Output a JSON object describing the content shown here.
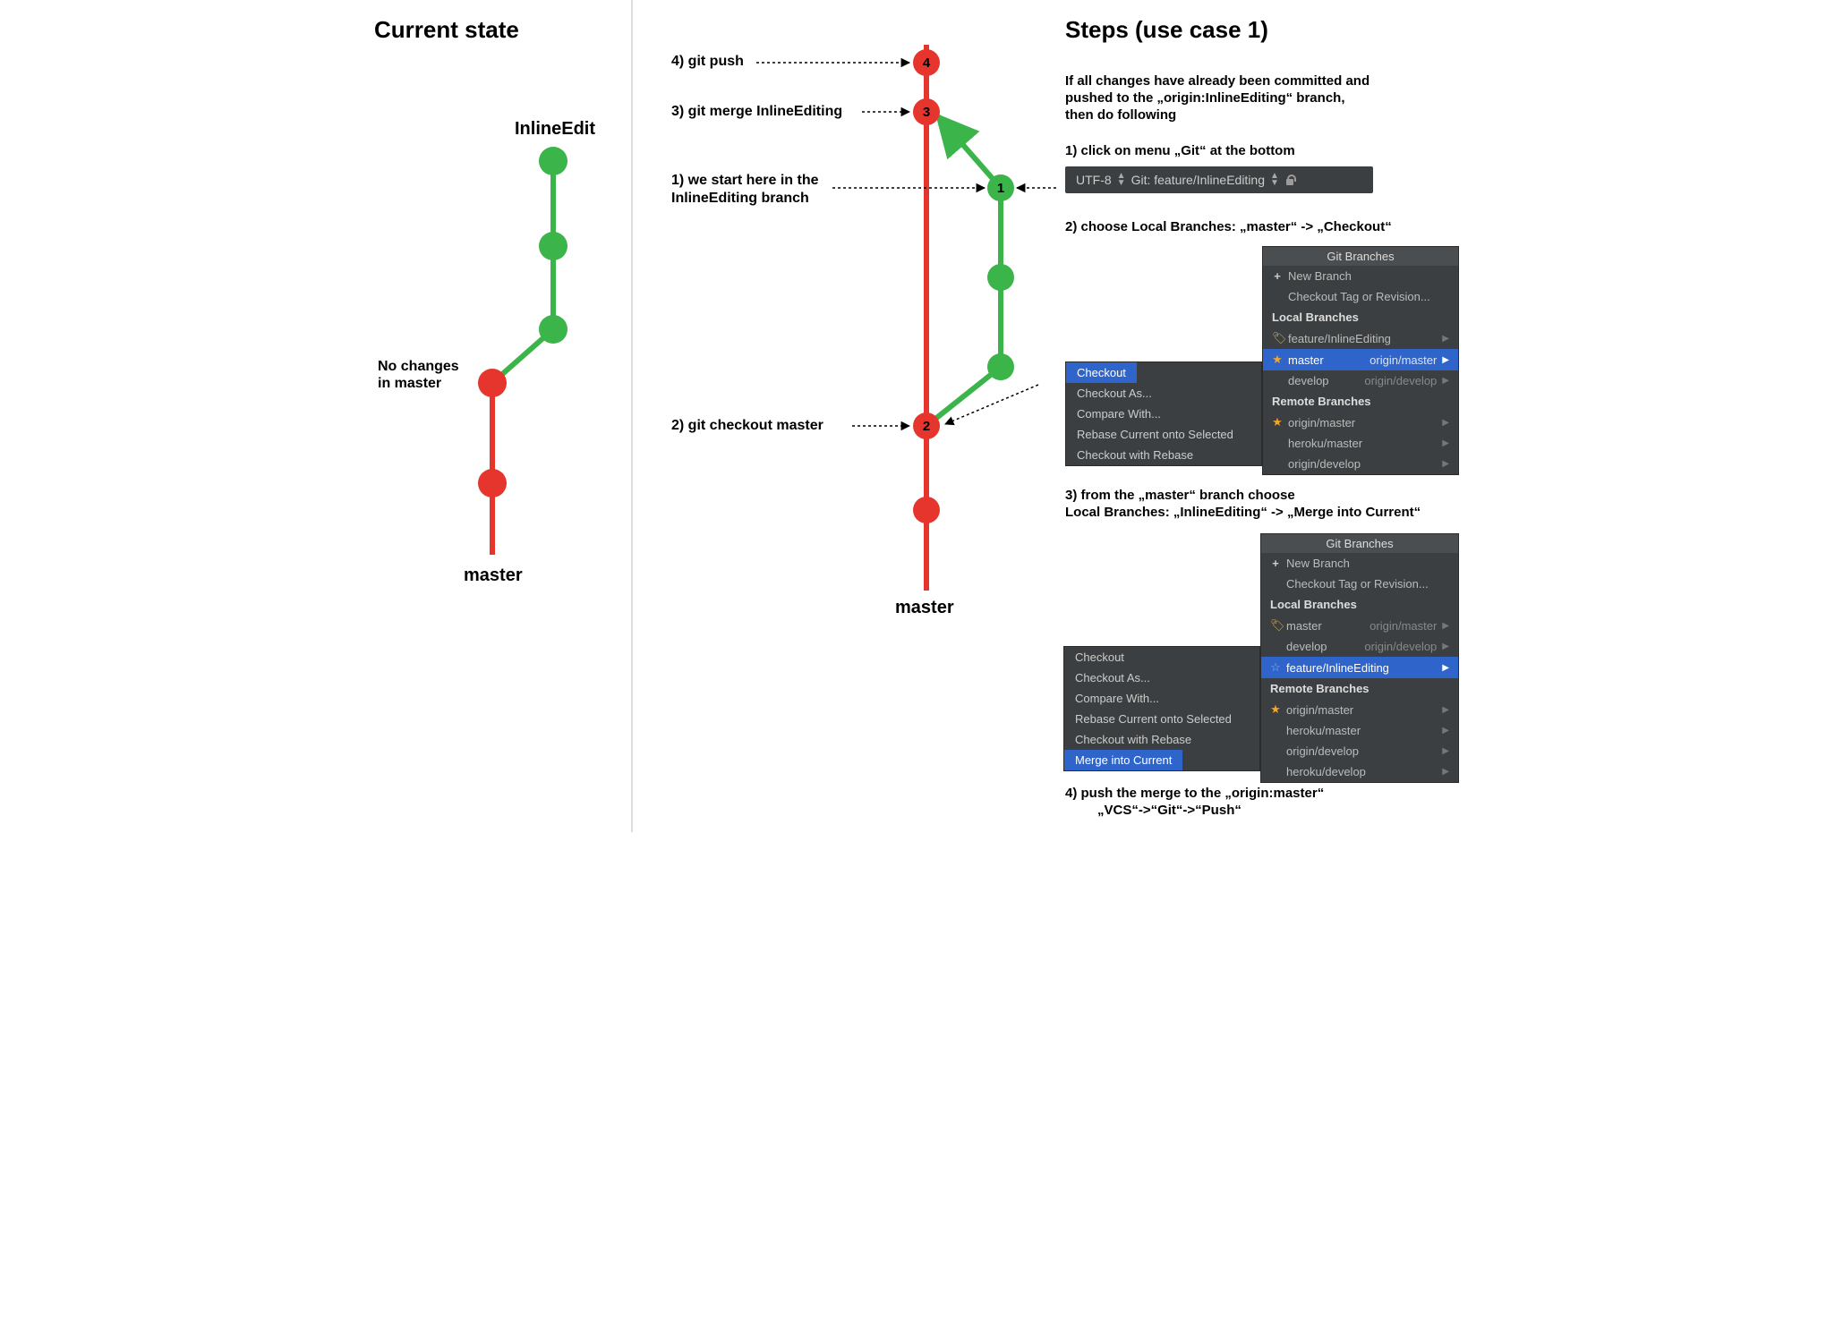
{
  "left": {
    "title": "Current state",
    "branch_label": "InlineEdit",
    "master_label": "master",
    "note_line1": "No changes",
    "note_line2": "in master"
  },
  "mid": {
    "step4": "4) git push",
    "step3": "3) git merge InlineEditing",
    "step1_line1": "1) we start here in the",
    "step1_line2": "InlineEditing branch",
    "step2": "2) git checkout master",
    "master_label": "master",
    "node1": "1",
    "node2": "2",
    "node3": "3",
    "node4": "4"
  },
  "right": {
    "title": "Steps (use case 1)",
    "intro_l1": "If all changes have already been committed and",
    "intro_l2": "pushed to the „origin:InlineEditing“ branch,",
    "intro_l3": "then do following",
    "s1": "1) click on menu „Git“ at the bottom",
    "statusbar": {
      "encoding": "UTF-8",
      "git": "Git: feature/InlineEditing"
    },
    "s2": "2) choose Local Branches: „master“ -> „Checkout“",
    "s3_l1": "3) from the „master“ branch choose",
    "s3_l2": "Local Branches: „InlineEditing“ -> „Merge into Current“",
    "s4_l1": "4) push the merge to the „origin:master“",
    "s4_l2": "„VCS“->“Git“->“Push“"
  },
  "panel_common": {
    "title": "Git Branches",
    "new_branch": "New Branch",
    "checkout_tag": "Checkout Tag or Revision...",
    "local_header": "Local Branches",
    "remote_header": "Remote Branches"
  },
  "panel_a": {
    "local": [
      {
        "icon": "tag",
        "name": "feature/InlineEditing",
        "remote": "",
        "sel": false
      },
      {
        "icon": "star",
        "name": "master",
        "remote": "origin/master",
        "sel": true
      },
      {
        "icon": "",
        "name": "develop",
        "remote": "origin/develop",
        "sel": false
      }
    ],
    "remote": [
      {
        "icon": "star",
        "name": "origin/master"
      },
      {
        "icon": "",
        "name": "heroku/master"
      },
      {
        "icon": "",
        "name": "origin/develop"
      }
    ]
  },
  "ctx_a": {
    "items": [
      "Checkout",
      "Checkout As...",
      "Compare With...",
      "Rebase Current onto Selected",
      "Checkout with Rebase"
    ],
    "selected": "Checkout"
  },
  "panel_b": {
    "local": [
      {
        "icon": "tag",
        "name": "master",
        "remote": "origin/master",
        "sel": false
      },
      {
        "icon": "",
        "name": "develop",
        "remote": "origin/develop",
        "sel": false
      },
      {
        "icon": "star-outline",
        "name": "feature/InlineEditing",
        "remote": "",
        "sel": true
      }
    ],
    "remote": [
      {
        "icon": "star",
        "name": "origin/master"
      },
      {
        "icon": "",
        "name": "heroku/master"
      },
      {
        "icon": "",
        "name": "origin/develop"
      },
      {
        "icon": "",
        "name": "heroku/develop"
      }
    ]
  },
  "ctx_b": {
    "items": [
      "Checkout",
      "Checkout As...",
      "Compare With...",
      "Rebase Current onto Selected",
      "Checkout with Rebase",
      "Merge into Current"
    ],
    "selected": "Merge into Current"
  },
  "chart_data": [
    {
      "type": "diagram",
      "title": "Current state — git commit graph",
      "nodes": [
        {
          "id": "m1",
          "branch": "master",
          "color": "red"
        },
        {
          "id": "m2",
          "branch": "master",
          "color": "red"
        },
        {
          "id": "f1",
          "branch": "InlineEdit",
          "color": "green",
          "parent": "m2"
        },
        {
          "id": "f2",
          "branch": "InlineEdit",
          "color": "green",
          "parent": "f1"
        },
        {
          "id": "f3",
          "branch": "InlineEdit",
          "color": "green",
          "parent": "f2",
          "head": true
        }
      ],
      "labels": {
        "master": "master",
        "feature": "InlineEdit",
        "note": "No changes in master"
      }
    },
    {
      "type": "diagram",
      "title": "Steps — merge feature into master",
      "nodes": [
        {
          "id": "c0",
          "branch": "master",
          "color": "red"
        },
        {
          "id": "c2",
          "branch": "master",
          "color": "red",
          "step": 2,
          "label": "git checkout master"
        },
        {
          "id": "g1",
          "branch": "feature",
          "color": "green",
          "step": 1,
          "label": "we start here in the InlineEditing branch",
          "parent": "c2"
        },
        {
          "id": "g2",
          "branch": "feature",
          "color": "green"
        },
        {
          "id": "g3",
          "branch": "feature",
          "color": "green"
        },
        {
          "id": "c3",
          "branch": "master",
          "color": "red",
          "step": 3,
          "label": "git merge InlineEditing",
          "parents": [
            "c2",
            "g1"
          ]
        },
        {
          "id": "c4",
          "branch": "master",
          "color": "red",
          "step": 4,
          "label": "git push",
          "parent": "c3"
        }
      ]
    }
  ]
}
